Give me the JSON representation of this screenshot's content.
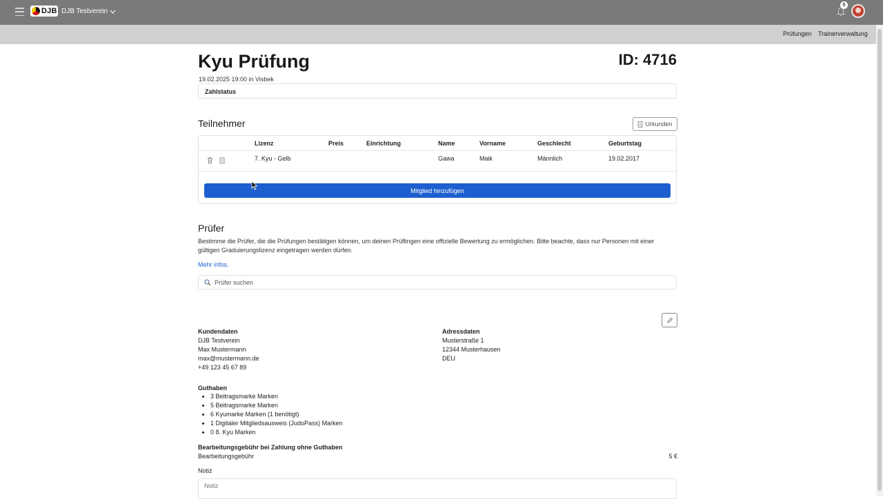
{
  "topbar": {
    "logo_text": "DJB",
    "club_name": "DJB Testverein",
    "notification_count": "5",
    "colors": {
      "bar": "#7a7a7a",
      "primary": "#1d5fcf"
    }
  },
  "subnav": {
    "items": [
      "Prüfungen",
      "Trainerverwaltung"
    ]
  },
  "exam": {
    "title": "Kyu Prüfung",
    "id_label": "ID: 4716",
    "date_location": "19.02.2025 19:00 in Visbek",
    "payment_status_label": "Zahlstatus"
  },
  "participants": {
    "heading": "Teilnehmer",
    "certificates_button": "Urkunden",
    "columns": [
      "Lizenz",
      "Preis",
      "Einrichtung",
      "Name",
      "Vorname",
      "Geschlecht",
      "Geburtstag"
    ],
    "rows": [
      {
        "lizenz": "7. Kyu - Gelb",
        "preis": "",
        "einrichtung": "",
        "name": "Gawa",
        "vorname": "Maik",
        "geschlecht": "Männlich",
        "geburtstag": "19.02.2017"
      }
    ],
    "add_button": "Mitglied hinzufügen"
  },
  "examiners": {
    "heading": "Prüfer",
    "description": "Bestimme die Prüfer, die die Prüfungen bestätigen können, um deinen Prüflingen eine offizielle Bewertung zu ermöglichen. Bitte beachte, dass nur Personen mit einer gültigen Graduierungslizenz eingetragen werden dürfen.",
    "more_link": "Mehr infos.",
    "search_placeholder": "Prüfer suchen"
  },
  "customer": {
    "heading": "Kundendaten",
    "lines": [
      "DJB Testverein",
      "Max Mustermann",
      "max@mustermann.de",
      "+49 123 45 67 89"
    ]
  },
  "address": {
    "heading": "Adressdaten",
    "lines": [
      "Musterstraße 1",
      "12344 Musterhausen",
      "DEU"
    ]
  },
  "credit": {
    "heading": "Guthaben",
    "items": [
      "3 Beitragsmarke Marken",
      "5 Beitragsmarke Marken",
      "6 Kyumarke Marken (1 benötigt)",
      "1 Digitaler Mitgliedsausweis (JudoPass) Marken",
      "0 8. Kyu Marken"
    ]
  },
  "fee": {
    "heading": "Bearbeitungsgebühr bei Zahlung ohne Guthaben",
    "label": "Bearbeitungsgebühr",
    "amount": "5 €"
  },
  "note": {
    "label": "Notiz",
    "placeholder": "Notiz"
  }
}
